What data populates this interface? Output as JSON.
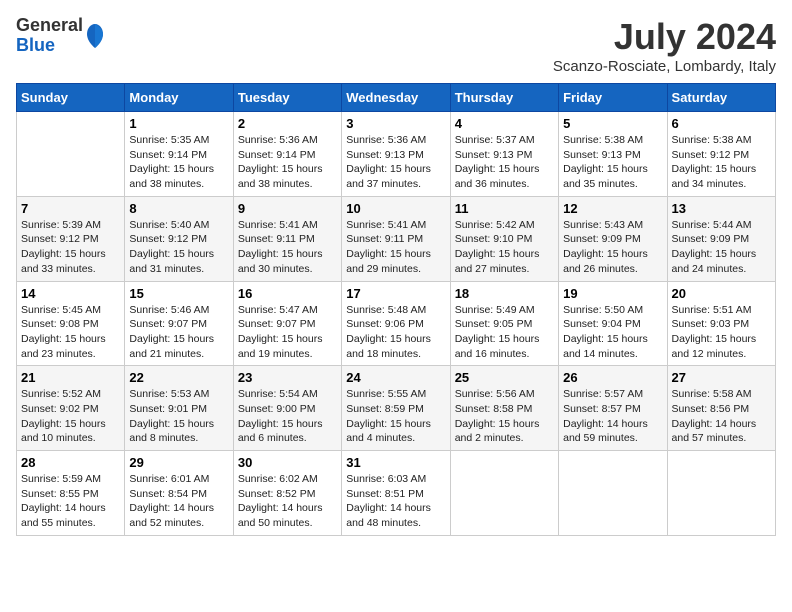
{
  "logo": {
    "general": "General",
    "blue": "Blue"
  },
  "title": {
    "month": "July 2024",
    "location": "Scanzo-Rosciate, Lombardy, Italy"
  },
  "headers": [
    "Sunday",
    "Monday",
    "Tuesday",
    "Wednesday",
    "Thursday",
    "Friday",
    "Saturday"
  ],
  "weeks": [
    [
      {
        "day": "",
        "sunrise": "",
        "sunset": "",
        "daylight": ""
      },
      {
        "day": "1",
        "sunrise": "Sunrise: 5:35 AM",
        "sunset": "Sunset: 9:14 PM",
        "daylight": "Daylight: 15 hours and 38 minutes."
      },
      {
        "day": "2",
        "sunrise": "Sunrise: 5:36 AM",
        "sunset": "Sunset: 9:14 PM",
        "daylight": "Daylight: 15 hours and 38 minutes."
      },
      {
        "day": "3",
        "sunrise": "Sunrise: 5:36 AM",
        "sunset": "Sunset: 9:13 PM",
        "daylight": "Daylight: 15 hours and 37 minutes."
      },
      {
        "day": "4",
        "sunrise": "Sunrise: 5:37 AM",
        "sunset": "Sunset: 9:13 PM",
        "daylight": "Daylight: 15 hours and 36 minutes."
      },
      {
        "day": "5",
        "sunrise": "Sunrise: 5:38 AM",
        "sunset": "Sunset: 9:13 PM",
        "daylight": "Daylight: 15 hours and 35 minutes."
      },
      {
        "day": "6",
        "sunrise": "Sunrise: 5:38 AM",
        "sunset": "Sunset: 9:12 PM",
        "daylight": "Daylight: 15 hours and 34 minutes."
      }
    ],
    [
      {
        "day": "7",
        "sunrise": "Sunrise: 5:39 AM",
        "sunset": "Sunset: 9:12 PM",
        "daylight": "Daylight: 15 hours and 33 minutes."
      },
      {
        "day": "8",
        "sunrise": "Sunrise: 5:40 AM",
        "sunset": "Sunset: 9:12 PM",
        "daylight": "Daylight: 15 hours and 31 minutes."
      },
      {
        "day": "9",
        "sunrise": "Sunrise: 5:41 AM",
        "sunset": "Sunset: 9:11 PM",
        "daylight": "Daylight: 15 hours and 30 minutes."
      },
      {
        "day": "10",
        "sunrise": "Sunrise: 5:41 AM",
        "sunset": "Sunset: 9:11 PM",
        "daylight": "Daylight: 15 hours and 29 minutes."
      },
      {
        "day": "11",
        "sunrise": "Sunrise: 5:42 AM",
        "sunset": "Sunset: 9:10 PM",
        "daylight": "Daylight: 15 hours and 27 minutes."
      },
      {
        "day": "12",
        "sunrise": "Sunrise: 5:43 AM",
        "sunset": "Sunset: 9:09 PM",
        "daylight": "Daylight: 15 hours and 26 minutes."
      },
      {
        "day": "13",
        "sunrise": "Sunrise: 5:44 AM",
        "sunset": "Sunset: 9:09 PM",
        "daylight": "Daylight: 15 hours and 24 minutes."
      }
    ],
    [
      {
        "day": "14",
        "sunrise": "Sunrise: 5:45 AM",
        "sunset": "Sunset: 9:08 PM",
        "daylight": "Daylight: 15 hours and 23 minutes."
      },
      {
        "day": "15",
        "sunrise": "Sunrise: 5:46 AM",
        "sunset": "Sunset: 9:07 PM",
        "daylight": "Daylight: 15 hours and 21 minutes."
      },
      {
        "day": "16",
        "sunrise": "Sunrise: 5:47 AM",
        "sunset": "Sunset: 9:07 PM",
        "daylight": "Daylight: 15 hours and 19 minutes."
      },
      {
        "day": "17",
        "sunrise": "Sunrise: 5:48 AM",
        "sunset": "Sunset: 9:06 PM",
        "daylight": "Daylight: 15 hours and 18 minutes."
      },
      {
        "day": "18",
        "sunrise": "Sunrise: 5:49 AM",
        "sunset": "Sunset: 9:05 PM",
        "daylight": "Daylight: 15 hours and 16 minutes."
      },
      {
        "day": "19",
        "sunrise": "Sunrise: 5:50 AM",
        "sunset": "Sunset: 9:04 PM",
        "daylight": "Daylight: 15 hours and 14 minutes."
      },
      {
        "day": "20",
        "sunrise": "Sunrise: 5:51 AM",
        "sunset": "Sunset: 9:03 PM",
        "daylight": "Daylight: 15 hours and 12 minutes."
      }
    ],
    [
      {
        "day": "21",
        "sunrise": "Sunrise: 5:52 AM",
        "sunset": "Sunset: 9:02 PM",
        "daylight": "Daylight: 15 hours and 10 minutes."
      },
      {
        "day": "22",
        "sunrise": "Sunrise: 5:53 AM",
        "sunset": "Sunset: 9:01 PM",
        "daylight": "Daylight: 15 hours and 8 minutes."
      },
      {
        "day": "23",
        "sunrise": "Sunrise: 5:54 AM",
        "sunset": "Sunset: 9:00 PM",
        "daylight": "Daylight: 15 hours and 6 minutes."
      },
      {
        "day": "24",
        "sunrise": "Sunrise: 5:55 AM",
        "sunset": "Sunset: 8:59 PM",
        "daylight": "Daylight: 15 hours and 4 minutes."
      },
      {
        "day": "25",
        "sunrise": "Sunrise: 5:56 AM",
        "sunset": "Sunset: 8:58 PM",
        "daylight": "Daylight: 15 hours and 2 minutes."
      },
      {
        "day": "26",
        "sunrise": "Sunrise: 5:57 AM",
        "sunset": "Sunset: 8:57 PM",
        "daylight": "Daylight: 14 hours and 59 minutes."
      },
      {
        "day": "27",
        "sunrise": "Sunrise: 5:58 AM",
        "sunset": "Sunset: 8:56 PM",
        "daylight": "Daylight: 14 hours and 57 minutes."
      }
    ],
    [
      {
        "day": "28",
        "sunrise": "Sunrise: 5:59 AM",
        "sunset": "Sunset: 8:55 PM",
        "daylight": "Daylight: 14 hours and 55 minutes."
      },
      {
        "day": "29",
        "sunrise": "Sunrise: 6:01 AM",
        "sunset": "Sunset: 8:54 PM",
        "daylight": "Daylight: 14 hours and 52 minutes."
      },
      {
        "day": "30",
        "sunrise": "Sunrise: 6:02 AM",
        "sunset": "Sunset: 8:52 PM",
        "daylight": "Daylight: 14 hours and 50 minutes."
      },
      {
        "day": "31",
        "sunrise": "Sunrise: 6:03 AM",
        "sunset": "Sunset: 8:51 PM",
        "daylight": "Daylight: 14 hours and 48 minutes."
      },
      {
        "day": "",
        "sunrise": "",
        "sunset": "",
        "daylight": ""
      },
      {
        "day": "",
        "sunrise": "",
        "sunset": "",
        "daylight": ""
      },
      {
        "day": "",
        "sunrise": "",
        "sunset": "",
        "daylight": ""
      }
    ]
  ]
}
